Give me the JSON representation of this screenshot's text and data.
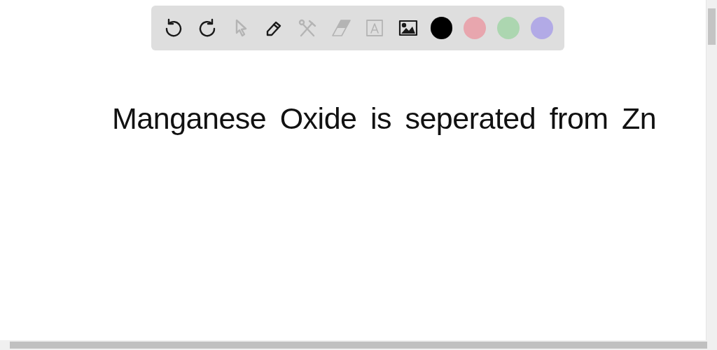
{
  "toolbar": {
    "tools": [
      {
        "kind": "undo",
        "disabled": false
      },
      {
        "kind": "redo",
        "disabled": false
      },
      {
        "kind": "select",
        "disabled": true
      },
      {
        "kind": "pen",
        "disabled": false
      },
      {
        "kind": "tools",
        "disabled": true
      },
      {
        "kind": "eraser",
        "disabled": true
      },
      {
        "kind": "text",
        "disabled": true
      },
      {
        "kind": "image",
        "disabled": false
      }
    ],
    "colors": [
      {
        "color": "#000000"
      },
      {
        "color": "#e8a6ae"
      },
      {
        "color": "#acd6b0"
      },
      {
        "color": "#b2aae6"
      }
    ]
  },
  "canvas": {
    "handwriting": "Manganese Oxide is seperated from Zn"
  }
}
